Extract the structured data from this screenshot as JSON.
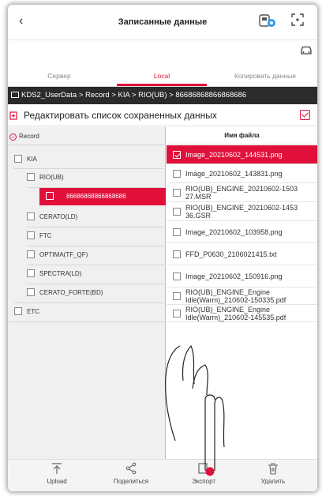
{
  "header": {
    "back_icon": "chevron-left-icon",
    "title": "Записанные данные",
    "vci_icon": "vci-connection-icon",
    "expand_icon": "fullscreen-icon",
    "car_icon": "car-icon"
  },
  "tabs": [
    {
      "label": "Сервер"
    },
    {
      "label": "Local"
    },
    {
      "label": "Копировать данные"
    }
  ],
  "path": "KDS2_UserData > Record > KIA > RIO(UB) > 86686868866868686",
  "edit": {
    "label": "Редактировать список сохраненных данных"
  },
  "tree": {
    "root": "Record",
    "items": [
      {
        "label": "KIA"
      },
      {
        "label": "RIO(UB)"
      },
      {
        "label": "86686868866868686"
      },
      {
        "label": "CERATO(LD)"
      },
      {
        "label": "FTC"
      },
      {
        "label": "OPTIMA(TF_QF)"
      },
      {
        "label": "SPECTRA(LD)"
      },
      {
        "label": "CERATO_FORTE(BD)"
      },
      {
        "label": "ETC"
      }
    ]
  },
  "files": {
    "header": "Имя файла",
    "rows": [
      {
        "name1": "Image_20210602_144531.png",
        "name2": ""
      },
      {
        "name1": "Image_20210602_143831.png",
        "name2": ""
      },
      {
        "name1": "RIO(UB)_ENGINE_20210602-1503",
        "name2": "27.MSR"
      },
      {
        "name1": "RIO(UB)_ENGINE_20210602-1453",
        "name2": "36.GSR"
      },
      {
        "name1": "Image_20210602_103958.png",
        "name2": ""
      },
      {
        "name1": "FFD_P0630_2106021415.txt",
        "name2": ""
      },
      {
        "name1": "Image_20210602_150916.png",
        "name2": ""
      },
      {
        "name1": "RIO(UB)_ENGINE_Engine",
        "name2": "Idle(Warm)_210602-150335.pdf"
      },
      {
        "name1": "RIO(UB)_ENGINE_Engine",
        "name2": "Idle(Warm)_210602-145535.pdf"
      }
    ]
  },
  "bottom": [
    {
      "label": "Upload",
      "icon": "upload-icon"
    },
    {
      "label": "Поделиться",
      "icon": "share-icon"
    },
    {
      "label": "Экспорт",
      "icon": "export-icon"
    },
    {
      "label": "Удалить",
      "icon": "trash-icon"
    }
  ],
  "colors": {
    "accent": "#e0103a",
    "path_bar": "#2b2b2b",
    "left_pane": "#f0f0f0"
  }
}
